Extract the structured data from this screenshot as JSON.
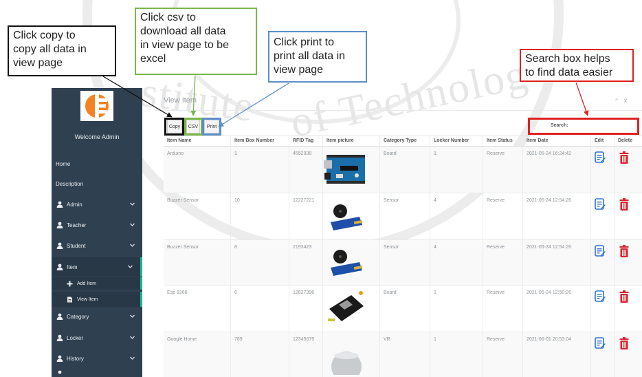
{
  "sidebar": {
    "welcome": "Welcome Admin",
    "plain_items": [
      {
        "label": "Home"
      },
      {
        "label": "Description"
      }
    ],
    "items": [
      {
        "label": "Admin"
      },
      {
        "label": "Teacher"
      },
      {
        "label": "Student"
      },
      {
        "label": "Item"
      },
      {
        "label": "Category"
      },
      {
        "label": "Locker"
      },
      {
        "label": "History"
      }
    ],
    "sub_items": [
      {
        "label": "Add Item"
      },
      {
        "label": "View Item"
      }
    ]
  },
  "panel": {
    "title": "View Item",
    "controls": "^ x"
  },
  "toolbar": {
    "copy_label": "Copy",
    "csv_label": "CSV",
    "print_label": "Print"
  },
  "search": {
    "label": "Search:",
    "value": ""
  },
  "table": {
    "columns": [
      "Item Name",
      "Item Box Number",
      "RFID Tag",
      "Item picture",
      "Category Type",
      "Locker Number",
      "Item Status",
      "Item Date",
      "Edit",
      "Delete"
    ],
    "rows": [
      {
        "name": "Arduino",
        "box": "1",
        "rfid": "4552938",
        "picture": "arduino-board",
        "category": "Board",
        "locker": "1",
        "status": "Reserve",
        "date": "2021-05-24 16:24:42"
      },
      {
        "name": "Buzzer Sensor",
        "box": "10",
        "rfid": "12227221",
        "picture": "buzzer-module",
        "category": "Sensor",
        "locker": "4",
        "status": "Reserve",
        "date": "2021-05-24 12:54:26"
      },
      {
        "name": "Buzzer Sensor",
        "box": "8",
        "rfid": "2193423",
        "picture": "buzzer-module",
        "category": "Sensor",
        "locker": "4",
        "status": "Reserve",
        "date": "2021-05-24 12:54:26"
      },
      {
        "name": "Esp 8266",
        "box": "6",
        "rfid": "12827396",
        "picture": "esp8266-board",
        "category": "Board",
        "locker": "1",
        "status": "Reserve",
        "date": "2021-05-24 12:50:26"
      },
      {
        "name": "Google Home",
        "box": "789",
        "rfid": "12345679",
        "picture": "google-home-speaker",
        "category": "VR",
        "locker": "1",
        "status": "Reserve",
        "date": "2021-06-01 20:53:04"
      }
    ]
  },
  "annotations": {
    "copy": "Click copy to\ncopy all data in\nview page",
    "csv": "Click csv to\ndownload all data\nin view page to be\nexcel",
    "print": "Click print to\nprint all data in\nview page",
    "search": "Search box helps\nto find data easier"
  },
  "colors": {
    "sidebar_bg": "#2f4050",
    "accent_active": "#1ab394",
    "edit_icon": "#2f72d6",
    "delete_icon": "#d9242d",
    "copy_box": "#111111",
    "csv_box": "#7ab648",
    "print_box": "#5b8fc9",
    "search_box": "#e02020"
  },
  "icons": {
    "logo": "ce-logo",
    "nav_user": "user-icon",
    "nav_chevron": "chevron-down-icon",
    "add": "plus-icon",
    "view": "document-icon",
    "edit": "edit-note-icon",
    "delete": "trash-icon"
  }
}
